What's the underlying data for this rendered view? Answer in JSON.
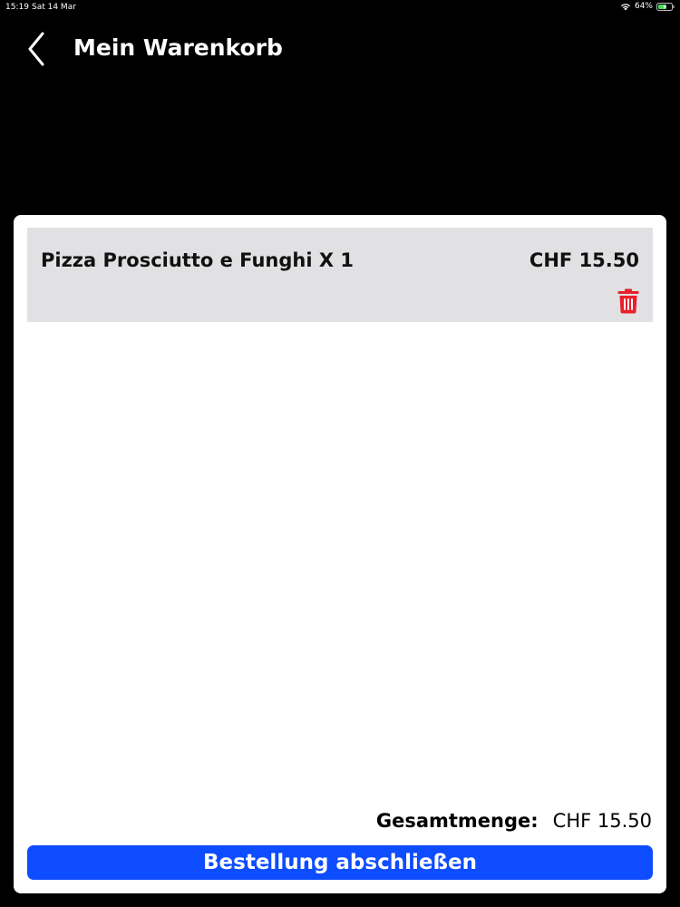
{
  "status_bar": {
    "time": "15:19",
    "date": "Sat 14 Mar",
    "battery": "64%"
  },
  "header": {
    "title": "Mein Warenkorb",
    "back_icon": "chevron-left-icon"
  },
  "cart": {
    "items": [
      {
        "name": "Pizza Prosciutto e Funghi X 1",
        "price": "CHF 15.50",
        "delete_icon": "trash-icon"
      }
    ],
    "total_label": "Gesamtmenge:",
    "total_value": "CHF 15.50",
    "checkout_label": "Bestellung abschließen"
  },
  "colors": {
    "background": "#000000",
    "card": "#ffffff",
    "item_background": "#e1e1e4",
    "delete": "#e8202a",
    "button": "#0d4cff"
  }
}
